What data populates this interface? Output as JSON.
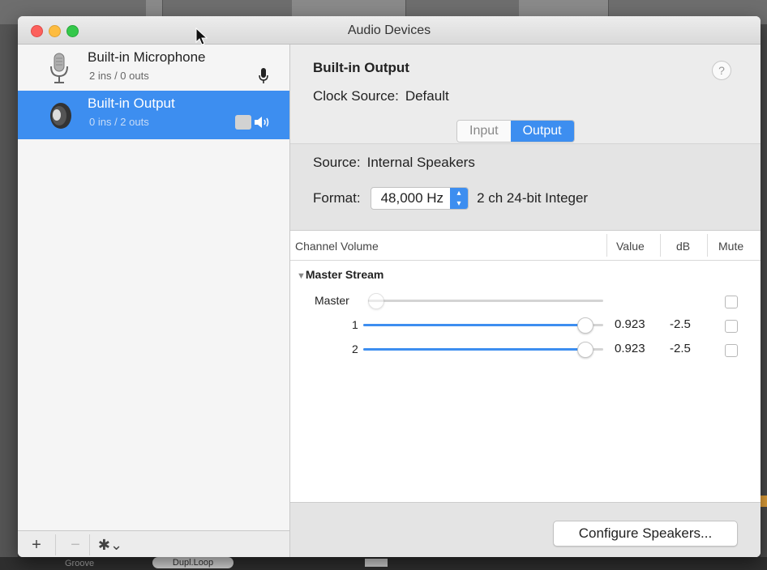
{
  "background_app": {
    "pill_label": "Dupl.Loop",
    "left_label": "Groove"
  },
  "window": {
    "title": "Audio Devices"
  },
  "sidebar": {
    "devices": [
      {
        "name": "Built-in Microphone",
        "io": "2 ins / 0 outs",
        "icon": "microphone-icon",
        "badge": "microphone-badge-icon",
        "selected": false
      },
      {
        "name": "Built-in Output",
        "io": "0 ins / 2 outs",
        "icon": "speaker-icon",
        "badge": "speaker-badge-icon",
        "selected": true
      }
    ],
    "footer": {
      "add_label": "+",
      "remove_label": "−",
      "gear_label": "✱⌄"
    }
  },
  "main": {
    "device_title": "Built-in Output",
    "help_label": "?",
    "clock_label": "Clock Source:",
    "clock_value": "Default",
    "tabs": [
      {
        "label": "Input",
        "selected": false
      },
      {
        "label": "Output",
        "selected": true
      }
    ],
    "source_label": "Source:",
    "source_value": "Internal Speakers",
    "format_label": "Format:",
    "format_value": "48,000 Hz",
    "format_desc": "2 ch 24-bit Integer",
    "table": {
      "headers": {
        "channel": "Channel Volume",
        "value": "Value",
        "db": "dB",
        "mute": "Mute"
      },
      "group": "Master Stream",
      "rows": [
        {
          "label": "Master",
          "volume": 0,
          "value": "",
          "db": "",
          "enabled": false,
          "muted": false
        },
        {
          "label": "1",
          "volume": 0.923,
          "value": "0.923",
          "db": "-2.5",
          "enabled": true,
          "muted": false
        },
        {
          "label": "2",
          "volume": 0.923,
          "value": "0.923",
          "db": "-2.5",
          "enabled": true,
          "muted": false
        }
      ]
    },
    "configure_label": "Configure Speakers..."
  },
  "colors": {
    "accent": "#3d8ef0",
    "close": "#fc605c",
    "minimize": "#fdbc40",
    "maximize": "#34c84a"
  }
}
